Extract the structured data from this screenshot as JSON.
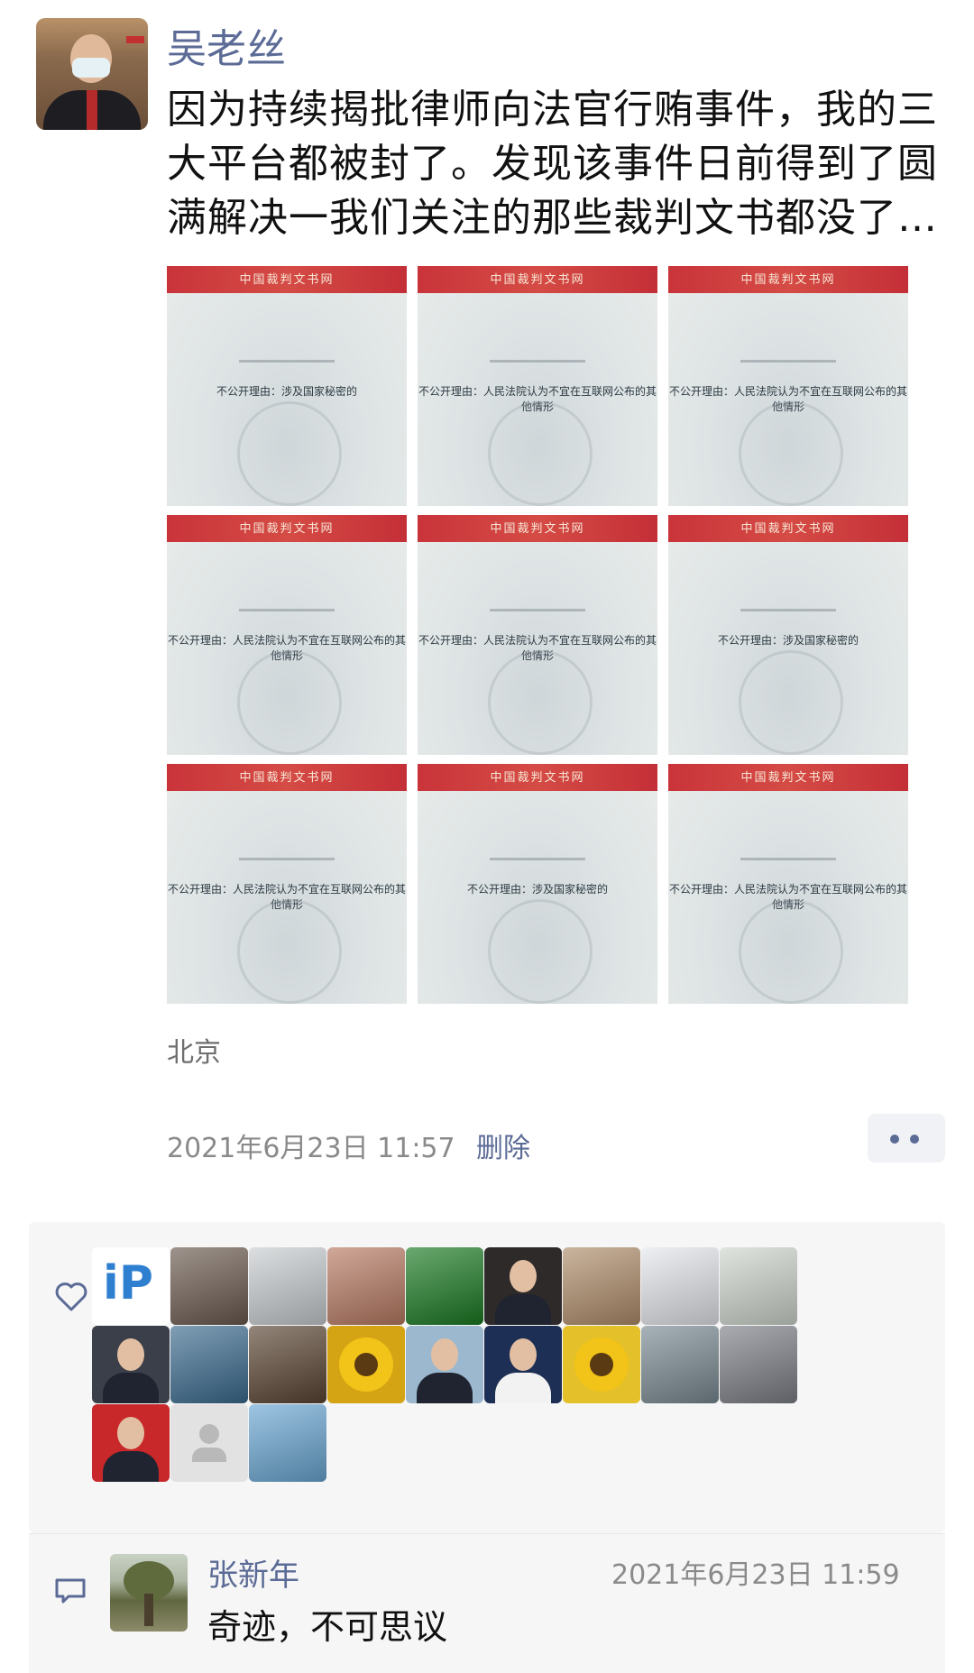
{
  "post": {
    "author": "吴老丝",
    "text": "因为持续揭批律师向法官行贿事件，我的三大平台都被封了。发现该事件日前得到了圆满解决一我们关注的那些裁判文书都没了…",
    "location": "北京",
    "timestamp": "2021年6月23日 11:57",
    "delete_label": "删除"
  },
  "images": [
    {
      "header": "中国裁判文书网",
      "title": "",
      "reason": "不公开理由：涉及国家秘密的"
    },
    {
      "header": "中国裁判文书网",
      "title": "",
      "reason": "不公开理由：人民法院认为不宜在互联网公布的其他情形"
    },
    {
      "header": "中国裁判文书网",
      "title": "",
      "reason": "不公开理由：人民法院认为不宜在互联网公布的其他情形"
    },
    {
      "header": "中国裁判文书网",
      "title": "",
      "reason": "不公开理由：人民法院认为不宜在互联网公布的其他情形"
    },
    {
      "header": "中国裁判文书网",
      "title": "",
      "reason": "不公开理由：人民法院认为不宜在互联网公布的其他情形"
    },
    {
      "header": "中国裁判文书网",
      "title": "",
      "reason": "不公开理由：涉及国家秘密的"
    },
    {
      "header": "中国裁判文书网",
      "title": "",
      "reason": "不公开理由：人民法院认为不宜在互联网公布的其他情形"
    },
    {
      "header": "中国裁判文书网",
      "title": "",
      "reason": "不公开理由：涉及国家秘密的"
    },
    {
      "header": "中国裁判文书网",
      "title": "",
      "reason": "不公开理由：人民法院认为不宜在互联网公布的其他情形"
    }
  ],
  "likes": {
    "icon": "heart-icon",
    "count": 21,
    "avatars": [
      {
        "icon": "ip-logo",
        "color": "#2f7fd1"
      },
      {
        "icon": "group-photo",
        "color": "#6b5a4f"
      },
      {
        "icon": "dancer-photo",
        "color": "#c9cdd0"
      },
      {
        "icon": "arm-photo",
        "color": "#b87a62"
      },
      {
        "icon": "jade-photo",
        "color": "#1a7a22"
      },
      {
        "icon": "portrait-man",
        "color": "#2e2a2a"
      },
      {
        "icon": "cat-photo",
        "color": "#b08d6a"
      },
      {
        "icon": "robot-photo",
        "color": "#e4e7ec"
      },
      {
        "icon": "panda-photo",
        "color": "#cfd6cf"
      },
      {
        "icon": "portrait-man",
        "color": "#3a3f4a"
      },
      {
        "icon": "lake-photo",
        "color": "#3b6b8f"
      },
      {
        "icon": "mountain-photo",
        "color": "#5a4432"
      },
      {
        "icon": "sunflower-photo",
        "color": "#d4a414"
      },
      {
        "icon": "portrait-man",
        "color": "#9bb8cf"
      },
      {
        "icon": "portrait-woman",
        "color": "#1e2f55"
      },
      {
        "icon": "sunflower-photo",
        "color": "#e4c02a"
      },
      {
        "icon": "lake-photo",
        "color": "#7a8a93"
      },
      {
        "icon": "family-photo",
        "color": "#7c7f86"
      },
      {
        "icon": "portrait-man",
        "color": "#c8282a"
      },
      {
        "icon": "default-avatar-icon",
        "color": "#e2e2e2"
      },
      {
        "icon": "sea-photo",
        "color": "#6aa7d4"
      }
    ]
  },
  "comment": {
    "icon": "comment-icon",
    "author": "张新年",
    "time": "2021年6月23日 11:59",
    "text": "奇迹，不可思议"
  }
}
